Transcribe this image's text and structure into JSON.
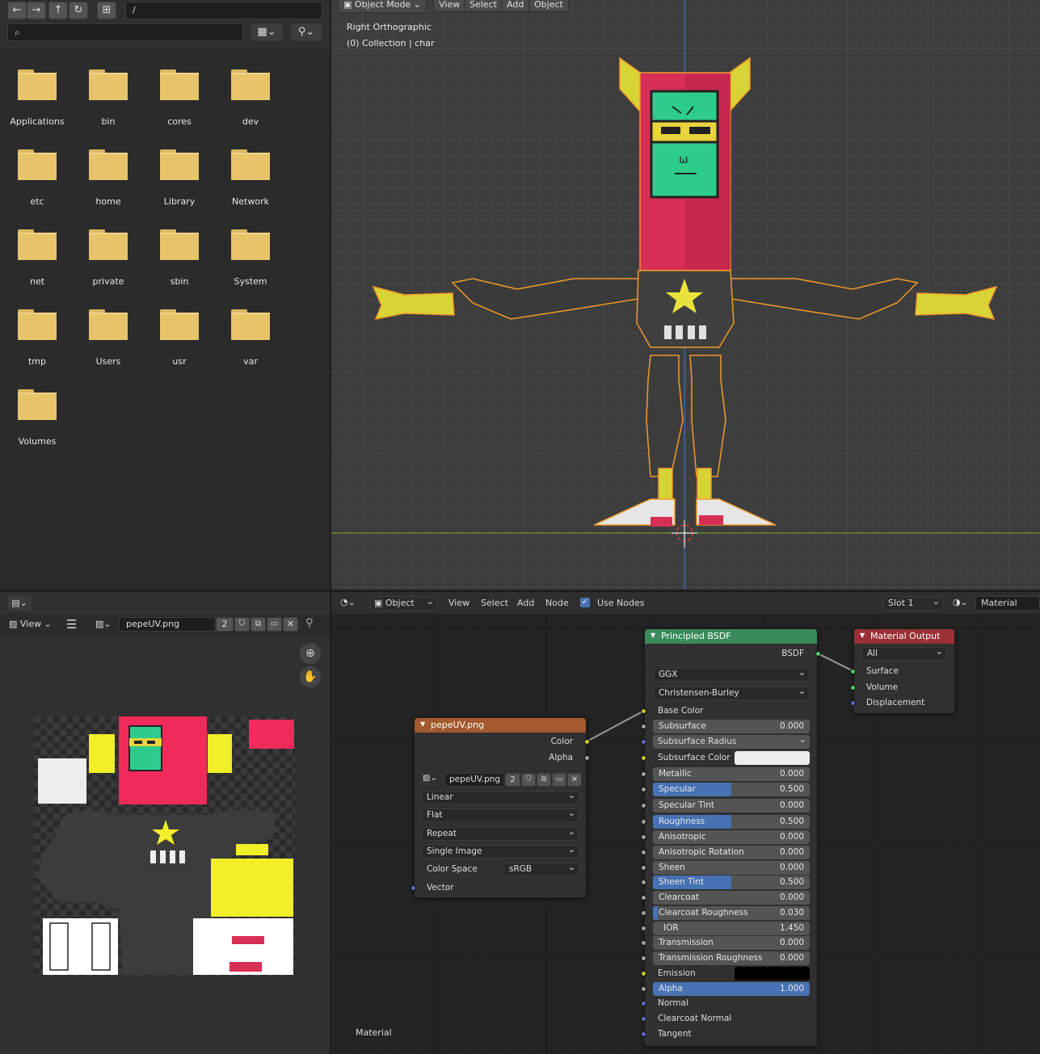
{
  "file_browser": {
    "path": "/",
    "search_placeholder": "",
    "folders": [
      "Applications",
      "bin",
      "cores",
      "dev",
      "etc",
      "home",
      "Library",
      "Network",
      "net",
      "private",
      "sbin",
      "System",
      "tmp",
      "Users",
      "usr",
      "var",
      "Volumes"
    ]
  },
  "viewport": {
    "mode": "Object Mode",
    "menus": [
      "View",
      "Select",
      "Add",
      "Object"
    ],
    "view_name": "Right Orthographic",
    "collection": "(0) Collection | char"
  },
  "image_editor": {
    "view_label": "View",
    "image_name": "pepeUV.png",
    "users": "2"
  },
  "node_editor": {
    "type_label": "Object",
    "menus": [
      "View",
      "Select",
      "Add",
      "Node"
    ],
    "use_nodes_label": "Use Nodes",
    "slot": "Slot 1",
    "material": "Material",
    "footer_label": "Material",
    "image_node": {
      "title": "pepeUV.png",
      "out_color": "Color",
      "out_alpha": "Alpha",
      "image": "pepeUV.png",
      "users": "2",
      "interpolation": "Linear",
      "projection": "Flat",
      "extension": "Repeat",
      "source": "Single Image",
      "color_space_label": "Color Space",
      "color_space": "sRGB",
      "in_vector": "Vector"
    },
    "bsdf_node": {
      "title": "Principled BSDF",
      "out": "BSDF",
      "distribution": "GGX",
      "subsurface_method": "Christensen-Burley",
      "base_color": "Base Color",
      "subsurface_radius": "Subsurface Radius",
      "subsurface_color": "Subsurface Color",
      "emission": "Emission",
      "normal": "Normal",
      "clearcoat_normal": "Clearcoat Normal",
      "tangent": "Tangent",
      "params": [
        {
          "label": "Subsurface",
          "value": "0.000",
          "fill": 0
        },
        {
          "label": "Metallic",
          "value": "0.000",
          "fill": 0
        },
        {
          "label": "Specular",
          "value": "0.500",
          "fill": 0.5
        },
        {
          "label": "Specular Tint",
          "value": "0.000",
          "fill": 0
        },
        {
          "label": "Roughness",
          "value": "0.500",
          "fill": 0.5
        },
        {
          "label": "Anisotropic",
          "value": "0.000",
          "fill": 0
        },
        {
          "label": "Anisotropic Rotation",
          "value": "0.000",
          "fill": 0
        },
        {
          "label": "Sheen",
          "value": "0.000",
          "fill": 0
        },
        {
          "label": "Sheen Tint",
          "value": "0.500",
          "fill": 0.5
        },
        {
          "label": "Clearcoat",
          "value": "0.000",
          "fill": 0
        },
        {
          "label": "Clearcoat Roughness",
          "value": "0.030",
          "fill": 0.03
        },
        {
          "label": "IOR",
          "value": "1.450",
          "fill": 0
        },
        {
          "label": "Transmission",
          "value": "0.000",
          "fill": 0
        },
        {
          "label": "Transmission Roughness",
          "value": "0.000",
          "fill": 0
        },
        {
          "label": "Alpha",
          "value": "1.000",
          "fill": 1
        }
      ]
    },
    "output_node": {
      "title": "Material Output",
      "target": "All",
      "surface": "Surface",
      "volume": "Volume",
      "displacement": "Displacement"
    }
  },
  "colors": {
    "accent": "#4772b3",
    "bsdf_header": "#3a8a5c",
    "image_header": "#a35a2c",
    "output_header": "#9a2f36",
    "folder": "#e7c46a"
  }
}
